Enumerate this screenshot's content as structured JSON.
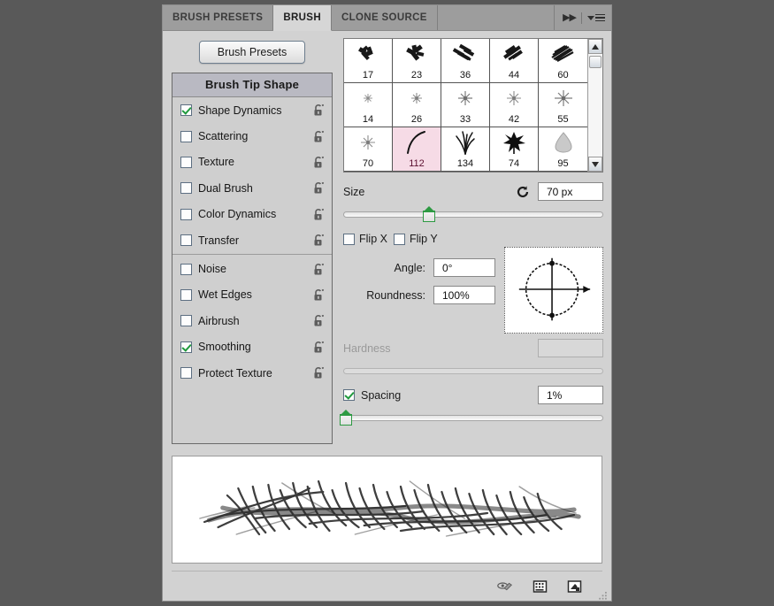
{
  "app": {
    "background_color": "#595959",
    "panel_background": "#d2d2d2"
  },
  "tabs": [
    {
      "label": "BRUSH PRESETS",
      "active": false
    },
    {
      "label": "BRUSH",
      "active": true
    },
    {
      "label": "CLONE SOURCE",
      "active": false
    }
  ],
  "tabbar_right": {
    "collapse_icon": "double-chevron-right-icon",
    "menu_icon": "panel-menu-icon"
  },
  "left_column": {
    "presets_button": "Brush Presets",
    "list_header": "Brush Tip Shape",
    "options": [
      {
        "label": "Shape Dynamics",
        "checked": true,
        "locked": false
      },
      {
        "label": "Scattering",
        "checked": false,
        "locked": false
      },
      {
        "label": "Texture",
        "checked": false,
        "locked": false
      },
      {
        "label": "Dual Brush",
        "checked": false,
        "locked": false
      },
      {
        "label": "Color Dynamics",
        "checked": false,
        "locked": false
      },
      {
        "label": "Transfer",
        "checked": false,
        "locked": false
      }
    ],
    "options_second_group": [
      {
        "label": "Noise",
        "checked": false,
        "locked": false
      },
      {
        "label": "Wet Edges",
        "checked": false,
        "locked": false
      },
      {
        "label": "Airbrush",
        "checked": false,
        "locked": false
      },
      {
        "label": "Smoothing",
        "checked": true,
        "locked": false
      },
      {
        "label": "Protect Texture",
        "checked": false,
        "locked": false
      }
    ]
  },
  "brush_grid": {
    "selected_size": "112",
    "selection_color": "#f6dbe6",
    "rows": [
      [
        {
          "num": "17",
          "style": "chalk",
          "selected": false
        },
        {
          "num": "23",
          "style": "chalk",
          "selected": false
        },
        {
          "num": "36",
          "style": "chalk",
          "selected": false
        },
        {
          "num": "44",
          "style": "chalk",
          "selected": false
        },
        {
          "num": "60",
          "style": "chalk",
          "selected": false
        }
      ],
      [
        {
          "num": "14",
          "style": "spatter",
          "selected": false
        },
        {
          "num": "26",
          "style": "spatter",
          "selected": false
        },
        {
          "num": "33",
          "style": "spatter",
          "selected": false
        },
        {
          "num": "42",
          "style": "spatter",
          "selected": false
        },
        {
          "num": "55",
          "style": "spatter",
          "selected": false
        }
      ],
      [
        {
          "num": "70",
          "style": "spatter",
          "selected": false
        },
        {
          "num": "112",
          "style": "curve",
          "selected": true
        },
        {
          "num": "134",
          "style": "grass",
          "selected": false
        },
        {
          "num": "74",
          "style": "star",
          "selected": false
        },
        {
          "num": "95",
          "style": "blob",
          "selected": false
        }
      ]
    ],
    "scrollbar": {
      "up_icon": "scroll-up-icon",
      "down_icon": "scroll-down-icon"
    }
  },
  "controls": {
    "size": {
      "label": "Size",
      "value": "70 px",
      "reset_icon": "reset-size-icon",
      "slider_percent": 33
    },
    "flip_x": {
      "label": "Flip X",
      "checked": false
    },
    "flip_y": {
      "label": "Flip Y",
      "checked": false
    },
    "angle": {
      "label": "Angle:",
      "value": "0°"
    },
    "roundness": {
      "label": "Roundness:",
      "value": "100%"
    },
    "angle_widget_icon": "angle-roundness-dial",
    "hardness": {
      "label": "Hardness",
      "value": "",
      "disabled": true,
      "slider_percent": 0
    },
    "spacing": {
      "label": "Spacing",
      "checked": true,
      "value": "1%",
      "slider_percent": 1
    }
  },
  "preview": {
    "name": "brush-stroke-preview"
  },
  "footer": {
    "icons": [
      {
        "name": "toggle-brush-preview-icon"
      },
      {
        "name": "open-preset-manager-icon"
      },
      {
        "name": "create-new-brush-icon"
      }
    ],
    "resize_grip": "resize-grip-icon"
  }
}
